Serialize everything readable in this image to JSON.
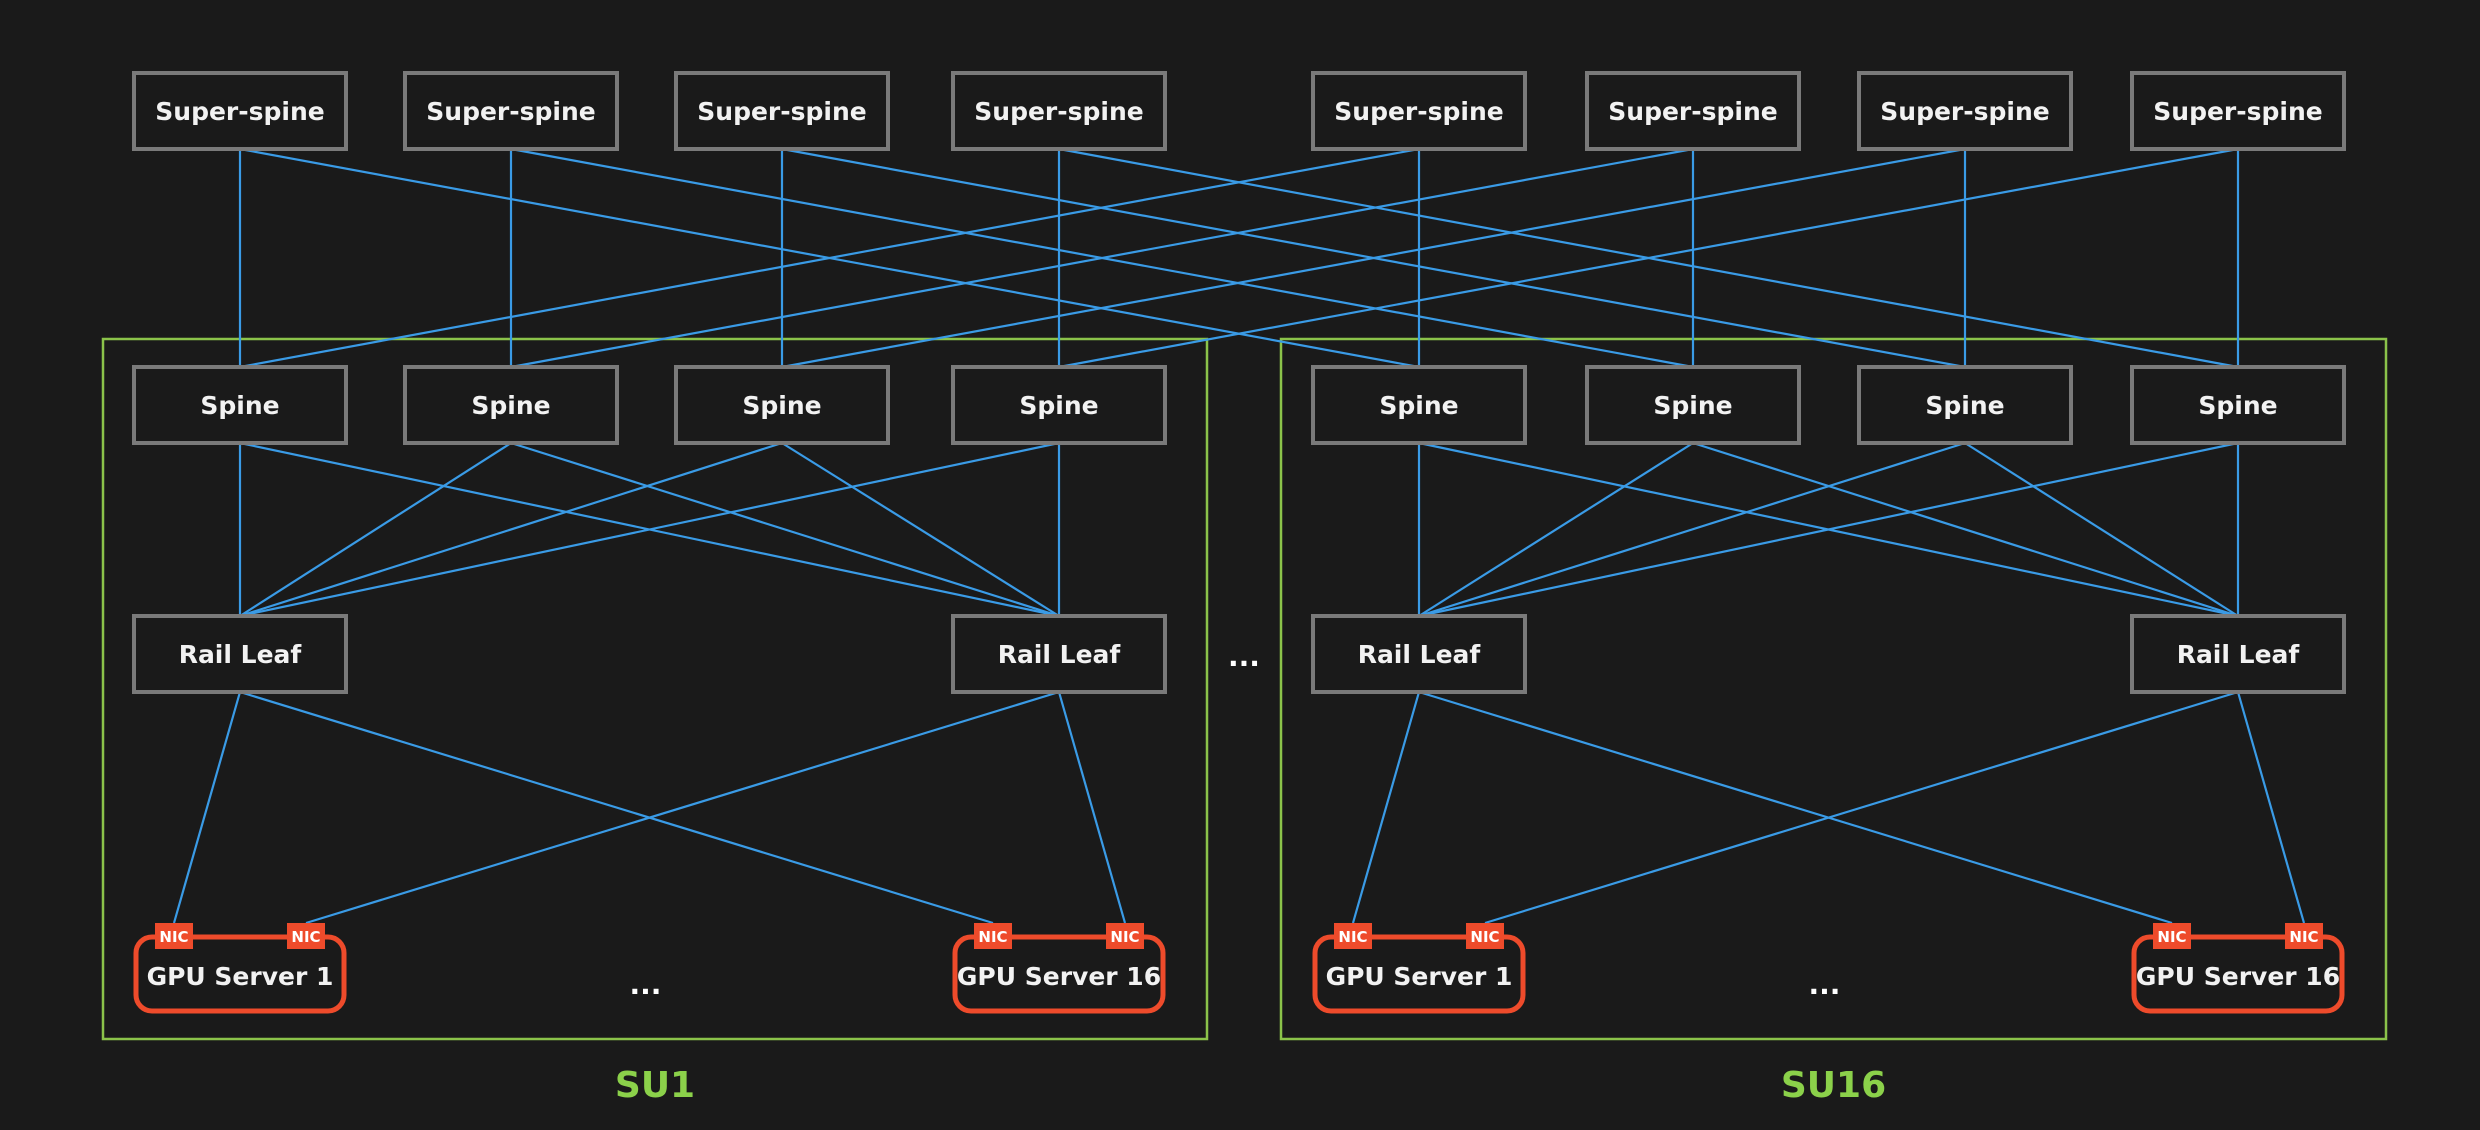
{
  "colors": {
    "background": "#1a1a1a",
    "node_border": "#7a7a7a",
    "link": "#3a9be6",
    "gpu_border": "#ee4b2b",
    "nic_fill": "#ee4b2b",
    "su_border": "#8bc34a",
    "su_label": "#8bd14a",
    "text": "#f2f2f2"
  },
  "labels": {
    "super_spine": "Super-spine",
    "spine": "Spine",
    "rail_leaf": "Rail Leaf",
    "nic": "NIC",
    "ellipsis": "..."
  },
  "super_spines": [
    {
      "label": "Super-spine",
      "connects_to_spines": [
        1,
        5
      ]
    },
    {
      "label": "Super-spine",
      "connects_to_spines": [
        2,
        6
      ]
    },
    {
      "label": "Super-spine",
      "connects_to_spines": [
        3,
        7
      ]
    },
    {
      "label": "Super-spine",
      "connects_to_spines": [
        4,
        8
      ]
    },
    {
      "label": "Super-spine",
      "connects_to_spines": [
        5,
        1
      ]
    },
    {
      "label": "Super-spine",
      "connects_to_spines": [
        6,
        2
      ]
    },
    {
      "label": "Super-spine",
      "connects_to_spines": [
        7,
        3
      ]
    },
    {
      "label": "Super-spine",
      "connects_to_spines": [
        8,
        4
      ]
    }
  ],
  "scalable_units": [
    {
      "label": "SU1",
      "spines": [
        "Spine",
        "Spine",
        "Spine",
        "Spine"
      ],
      "rail_leaves": [
        "Rail Leaf",
        "Rail Leaf"
      ],
      "gpu_servers": [
        {
          "label": "GPU Server 1",
          "nics": [
            "NIC",
            "NIC"
          ]
        },
        {
          "label": "GPU Server 16",
          "nics": [
            "NIC",
            "NIC"
          ]
        }
      ],
      "servers_ellipsis": "..."
    },
    {
      "label": "SU16",
      "spines": [
        "Spine",
        "Spine",
        "Spine",
        "Spine"
      ],
      "rail_leaves": [
        "Rail Leaf",
        "Rail Leaf"
      ],
      "gpu_servers": [
        {
          "label": "GPU Server 1",
          "nics": [
            "NIC",
            "NIC"
          ]
        },
        {
          "label": "GPU Server 16",
          "nics": [
            "NIC",
            "NIC"
          ]
        }
      ],
      "servers_ellipsis": "..."
    }
  ],
  "between_su_ellipsis": "...",
  "topology": {
    "spine_to_leaf": "full-mesh",
    "leaf_to_gpu": "each rail leaf connects to one NIC on every GPU server (NIC1 to leaf 1, NIC2 to leaf 2)"
  }
}
